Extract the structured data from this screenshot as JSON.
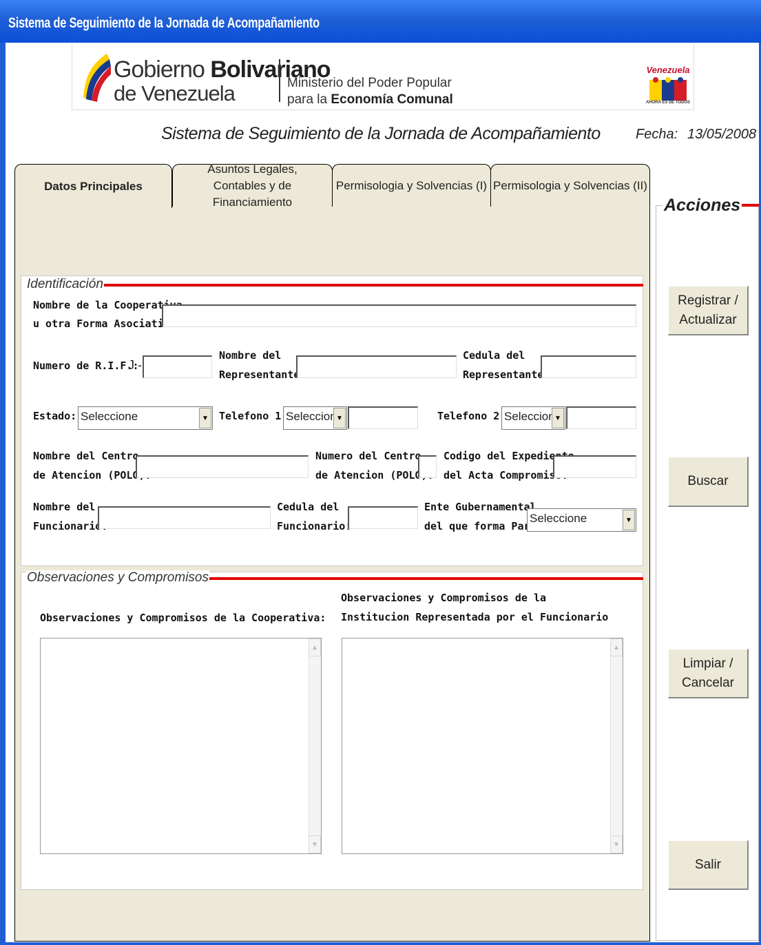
{
  "window": {
    "title": "Sistema de Seguimiento de la Jornada de Acompañamiento"
  },
  "banner": {
    "gov_line1_prefix": "Gobierno ",
    "gov_line1_bold": "Bolivariano",
    "gov_line2": "de Venezuela",
    "ministry_line1": "Ministerio del Poder Popular",
    "ministry_line2_prefix": "para la ",
    "ministry_line2_bold": "Economía Comunal",
    "right_logo_text": "Venezuela",
    "right_logo_sub": "AHORA ES DE TODOS"
  },
  "header": {
    "app_title": "Sistema de Seguimiento de la Jornada de Acompañamiento",
    "fecha_label": "Fecha:",
    "fecha_value": "13/05/2008"
  },
  "tabs": [
    {
      "label": "Datos Principales",
      "active": true
    },
    {
      "label": "Asuntos Legales, Contables y de Financiamiento",
      "active": false
    },
    {
      "label": "Permisologia y Solvencias (I)",
      "active": false
    },
    {
      "label": "Permisologia y Solvencias (II)",
      "active": false
    }
  ],
  "identificacion": {
    "legend": "Identificación",
    "nombre_coop_l1": "Nombre de la Cooperativa",
    "nombre_coop_l2": "u otra Forma Asociativa",
    "rif_label": "Numero de R.I.F.:",
    "rif_prefix": "J -",
    "nombre_rep_l1": "Nombre del",
    "nombre_rep_l2": "Representante:",
    "cedula_rep_l1": "Cedula del",
    "cedula_rep_l2": "Representante:",
    "estado_label": "Estado:",
    "estado_value": "Seleccione",
    "tel1_label": "Telefono 1:",
    "tel1_value": "Seleccione",
    "tel2_label": "Telefono 2:",
    "tel2_value": "Seleccione",
    "centro_nombre_l1": "Nombre del Centro",
    "centro_nombre_l2": "de Atencion (POLO):",
    "centro_num_l1": "Numero del Centro",
    "centro_num_l2": "de Atencion (POLO):",
    "codigo_l1": "Codigo del Expediente",
    "codigo_l2": "del Acta Compromiso:",
    "func_nombre_l1": "Nombre del",
    "func_nombre_l2": "Funcionario:",
    "func_cedula_l1": "Cedula del",
    "func_cedula_l2": "Funcionario:",
    "ente_l1": "Ente Gubernamental",
    "ente_l2": "del que forma Parte:",
    "ente_value": "Seleccione"
  },
  "observaciones": {
    "legend": "Observaciones y Compromisos",
    "coop_label": "Observaciones y Compromisos de la Cooperativa:",
    "inst_l1": "Observaciones y Compromisos de la",
    "inst_l2": "Institucion Representada por el Funcionario"
  },
  "acciones": {
    "legend": "Acciones",
    "registrar_l1": "Registrar /",
    "registrar_l2": "Actualizar",
    "buscar": "Buscar",
    "limpiar_l1": "Limpiar /",
    "limpiar_l2": "Cancelar",
    "salir": "Salir"
  },
  "colors": {
    "accent_line": "#e00000",
    "titlebar": "#1f5fd6",
    "panel": "#ece9d8"
  }
}
